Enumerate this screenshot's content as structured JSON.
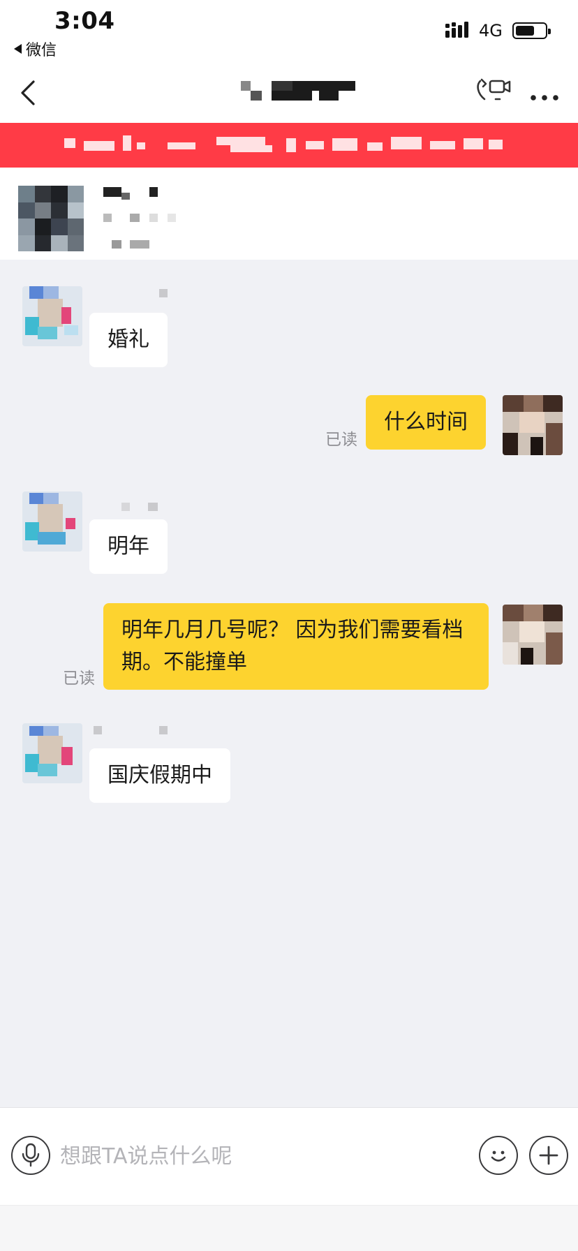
{
  "status_bar": {
    "time": "3:04",
    "back_app_label": "微信",
    "network": "4G"
  },
  "nav": {
    "back_icon": "chevron-left-icon",
    "call_icon": "video-call-icon",
    "more_icon": "more-dots-icon"
  },
  "banner": {
    "color": "#ff3b46"
  },
  "messages": [
    {
      "direction": "incoming",
      "text": "婚礼",
      "read_label": ""
    },
    {
      "direction": "outgoing",
      "text": "什么时间",
      "read_label": "已读"
    },
    {
      "direction": "incoming",
      "text": "明年",
      "read_label": ""
    },
    {
      "direction": "outgoing",
      "text": "明年几月几号呢？ 因为我们需要看档期。不能撞单",
      "read_label": "已读"
    },
    {
      "direction": "incoming",
      "text": "国庆假期中",
      "read_label": ""
    }
  ],
  "input": {
    "placeholder": "想跟TA说点什么呢",
    "value": "",
    "mic_icon": "microphone-icon",
    "emoji_icon": "emoji-icon",
    "plus_icon": "plus-icon"
  },
  "colors": {
    "outgoing_bubble": "#fdd32f",
    "incoming_bubble": "#ffffff",
    "chat_background": "#f0f1f5",
    "accent_red": "#ff3b46"
  }
}
